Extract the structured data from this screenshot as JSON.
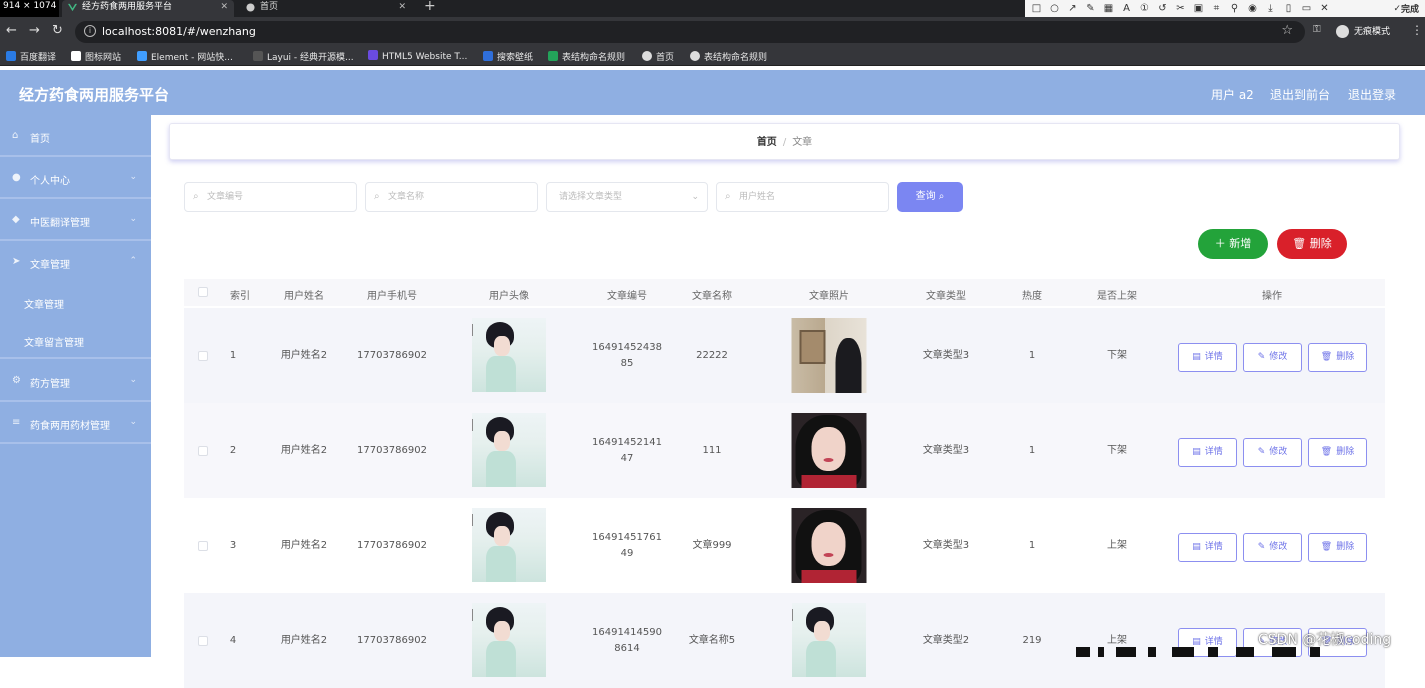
{
  "browser": {
    "dims_label": "914 × 1074",
    "tabs": [
      {
        "title": "经方药食两用服务平台",
        "active": true
      },
      {
        "title": "首页",
        "active": false
      }
    ],
    "url": "localhost:8081/#/wenzhang",
    "incognito_label": "无痕模式",
    "snip_done_label": "完成",
    "bookmarks": [
      {
        "label": "百度翻译",
        "color": "#2a7be4"
      },
      {
        "label": "图标网站",
        "color": "#ffffff"
      },
      {
        "label": "Element - 网站快...",
        "color": "#409eff"
      },
      {
        "label": "Layui - 经典开源模...",
        "color": "#333333"
      },
      {
        "label": "HTML5 Website T...",
        "color": "#6a4be0"
      },
      {
        "label": "搜索壁纸",
        "color": "#2f6fdb"
      },
      {
        "label": "表结构命名规则",
        "color": "#23a35a"
      },
      {
        "label": "首页",
        "color": "#dddddd"
      },
      {
        "label": "表结构命名规则",
        "color": "#dddddd"
      }
    ]
  },
  "header": {
    "title": "经方药食两用服务平台",
    "user": "用户 a2",
    "back_front": "退出到前台",
    "logout": "退出登录"
  },
  "sidebar": {
    "items": [
      {
        "label": "首页",
        "icon": "home-icon"
      },
      {
        "label": "个人中心",
        "icon": "user-icon"
      },
      {
        "label": "中医翻译管理",
        "icon": "tag-icon"
      },
      {
        "label": "文章管理",
        "icon": "send-icon"
      }
    ],
    "subitems": [
      {
        "label": "文章管理"
      },
      {
        "label": "文章留言管理"
      }
    ],
    "items_after": [
      {
        "label": "药方管理",
        "icon": "cog-icon"
      },
      {
        "label": "药食两用药材管理",
        "icon": "menu-icon"
      }
    ]
  },
  "breadcrumb": {
    "home": "首页",
    "sep": "/",
    "current": "文章"
  },
  "search": {
    "article_no_placeholder": "文章编号",
    "article_name_placeholder": "文章名称",
    "type_placeholder": "请选择文章类型",
    "user_name_placeholder": "用户姓名",
    "query_label": "查询"
  },
  "actions": {
    "add_label": "新增",
    "delete_label": "删除"
  },
  "table": {
    "headers": [
      "索引",
      "用户姓名",
      "用户手机号",
      "用户头像",
      "文章编号",
      "文章名称",
      "文章照片",
      "文章类型",
      "热度",
      "是否上架",
      "操作"
    ],
    "op_labels": {
      "detail": "详情",
      "edit": "修改",
      "delete": "删除"
    },
    "rows": [
      {
        "index": "1",
        "name": "用户姓名2",
        "phone": "17703786902",
        "number": "16491452438\n85",
        "title": "22222",
        "type": "文章类型3",
        "heat": "1",
        "status": "下架"
      },
      {
        "index": "2",
        "name": "用户姓名2",
        "phone": "17703786902",
        "number": "16491452141\n47",
        "title": "111",
        "type": "文章类型3",
        "heat": "1",
        "status": "下架"
      },
      {
        "index": "3",
        "name": "用户姓名2",
        "phone": "17703786902",
        "number": "16491451761\n49",
        "title": "文章999",
        "type": "文章类型3",
        "heat": "1",
        "status": "上架"
      },
      {
        "index": "4",
        "name": "用户姓名2",
        "phone": "17703786902",
        "number": "16491414590\n8614",
        "title": "文章名称5",
        "type": "文章类型2",
        "heat": "219",
        "status": "上架"
      }
    ]
  },
  "watermark": "CSDN @花椒coding"
}
